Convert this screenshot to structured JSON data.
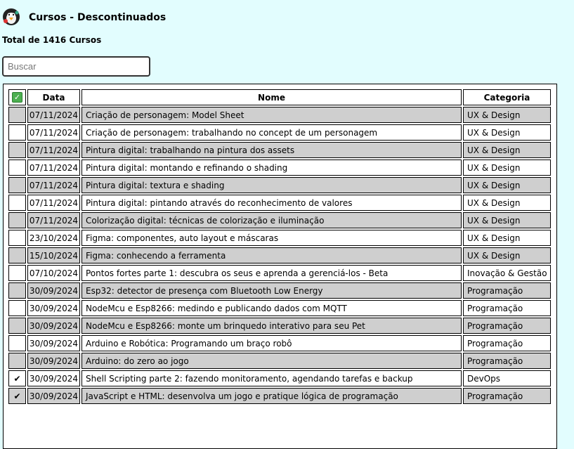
{
  "header": {
    "title": "Cursos - Descontinuados",
    "logo_icon": "penguin-avatar-icon"
  },
  "summary": {
    "total": "Total de 1416 Cursos"
  },
  "search": {
    "placeholder": "Buscar",
    "value": ""
  },
  "table": {
    "headers": {
      "check": "✓",
      "date": "Data",
      "name": "Nome",
      "category": "Categoria"
    },
    "rows": [
      {
        "checked": "",
        "date": "07/11/2024",
        "name": "Criação de personagem: Model Sheet",
        "category": "UX & Design"
      },
      {
        "checked": "",
        "date": "07/11/2024",
        "name": "Criação de personagem: trabalhando no concept de um personagem",
        "category": "UX & Design"
      },
      {
        "checked": "",
        "date": "07/11/2024",
        "name": "Pintura digital: trabalhando na pintura dos assets",
        "category": "UX & Design"
      },
      {
        "checked": "",
        "date": "07/11/2024",
        "name": "Pintura digital: montando e refinando o shading",
        "category": "UX & Design"
      },
      {
        "checked": "",
        "date": "07/11/2024",
        "name": "Pintura digital: textura e shading",
        "category": "UX & Design"
      },
      {
        "checked": "",
        "date": "07/11/2024",
        "name": "Pintura digital: pintando através do reconhecimento de valores",
        "category": "UX & Design"
      },
      {
        "checked": "",
        "date": "07/11/2024",
        "name": "Colorização digital: técnicas de colorização e iluminação",
        "category": "UX & Design"
      },
      {
        "checked": "",
        "date": "23/10/2024",
        "name": "Figma: componentes, auto layout e máscaras",
        "category": "UX & Design"
      },
      {
        "checked": "",
        "date": "15/10/2024",
        "name": "Figma: conhecendo a ferramenta",
        "category": "UX & Design"
      },
      {
        "checked": "",
        "date": "07/10/2024",
        "name": "Pontos fortes parte 1: descubra os seus e aprenda a gerenciá-los - Beta",
        "category": "Inovação & Gestão"
      },
      {
        "checked": "",
        "date": "30/09/2024",
        "name": "Esp32: detector de presença com Bluetooth Low Energy",
        "category": "Programação"
      },
      {
        "checked": "",
        "date": "30/09/2024",
        "name": "NodeMcu e Esp8266: medindo e publicando dados com MQTT",
        "category": "Programação"
      },
      {
        "checked": "",
        "date": "30/09/2024",
        "name": "NodeMcu e Esp8266: monte um brinquedo interativo para seu Pet",
        "category": "Programação"
      },
      {
        "checked": "",
        "date": "30/09/2024",
        "name": "Arduino e Robótica: Programando um braço robô",
        "category": "Programação"
      },
      {
        "checked": "",
        "date": "30/09/2024",
        "name": "Arduino: do zero ao jogo",
        "category": "Programação"
      },
      {
        "checked": "✔",
        "date": "30/09/2024",
        "name": "Shell Scripting parte 2: fazendo monitoramento, agendando tarefas e backup",
        "category": "DevOps"
      },
      {
        "checked": "✔",
        "date": "30/09/2024",
        "name": "JavaScript e HTML: desenvolva um jogo e pratique lógica de programação",
        "category": "Programação"
      }
    ]
  },
  "colors": {
    "background": "#e2fdfe",
    "row_alt": "#cfcfcf",
    "check_green": "#4caf50"
  }
}
